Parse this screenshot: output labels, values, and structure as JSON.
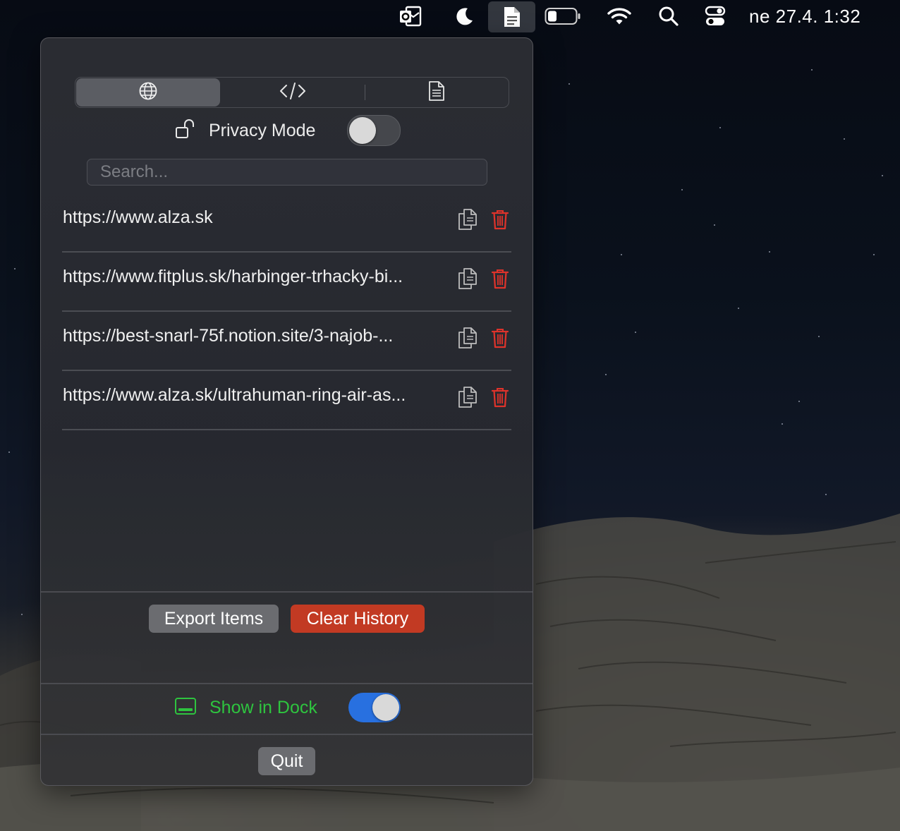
{
  "menubar": {
    "icons": [
      "outlook-icon",
      "moon-icon",
      "document-icon",
      "battery-icon",
      "wifi-icon",
      "search-icon",
      "control-center-icon"
    ],
    "clock": "ne 27.4.  1:32"
  },
  "panel": {
    "tabs": [
      {
        "icon": "globe-icon",
        "selected": true
      },
      {
        "icon": "code-icon",
        "selected": false
      },
      {
        "icon": "document-icon",
        "selected": false
      }
    ],
    "privacy": {
      "label": "Privacy Mode",
      "enabled": false
    },
    "search": {
      "placeholder": "Search...",
      "value": ""
    },
    "items": [
      {
        "url": "https://www.alza.sk"
      },
      {
        "url": "https://www.fitplus.sk/harbinger-trhacky-bi..."
      },
      {
        "url": "https://best-snarl-75f.notion.site/3-najob-..."
      },
      {
        "url": "https://www.alza.sk/ultrahuman-ring-air-as..."
      }
    ],
    "actions": {
      "export_label": "Export Items",
      "clear_label": "Clear History"
    },
    "dock": {
      "label": "Show in Dock",
      "enabled": true
    },
    "quit_label": "Quit"
  },
  "colors": {
    "clear_history": "#c23a23",
    "dock_label": "#2ec43f",
    "toggle_on": "#2870e0",
    "trash_icon": "#e0332b"
  }
}
